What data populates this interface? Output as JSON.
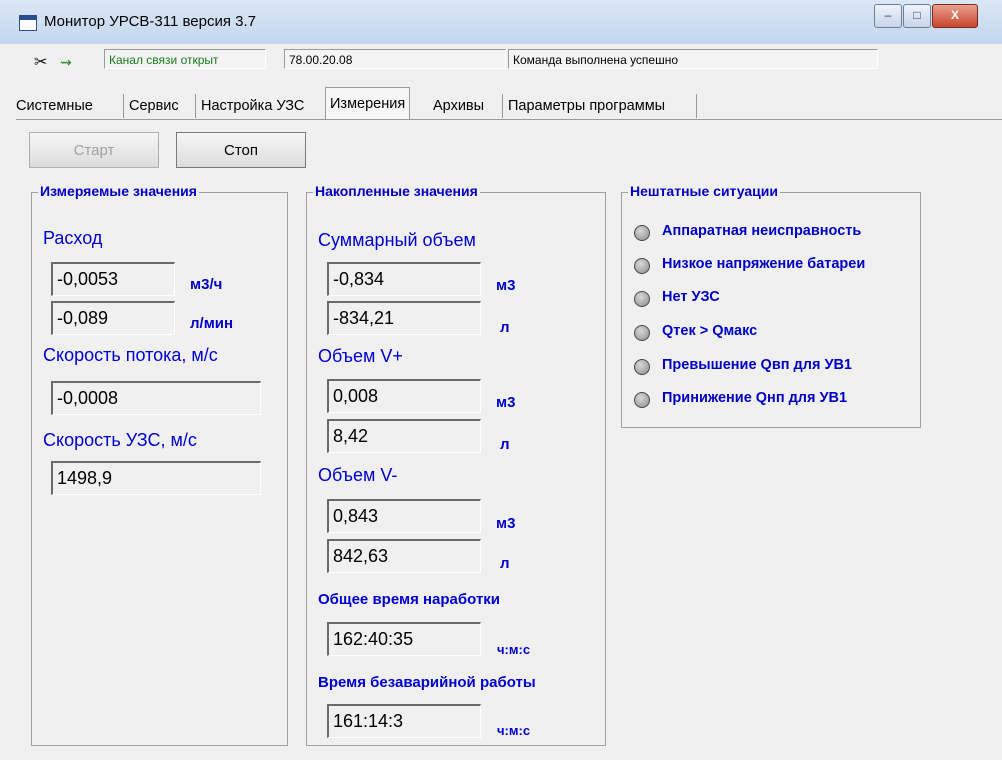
{
  "window": {
    "title": "Монитор УРСВ-311 версия 3.7",
    "minimize": "–",
    "maximize": "□",
    "close": "X"
  },
  "toolbar": {
    "disconnect_icon": "scissors-plug-icon",
    "connect_icon": "plug-arrow-icon",
    "channel_status": "Канал связи открыт",
    "address": "78.00.20.08",
    "command_status": "Команда выполнена успешно"
  },
  "tabs": [
    "Системные",
    "Сервис",
    "Настройка УЗС",
    "Измерения",
    "Архивы",
    "Параметры программы"
  ],
  "active_tab": "Измерения",
  "buttons": {
    "start": "Старт",
    "stop": "Стоп"
  },
  "measured": {
    "title": "Измеряемые значения",
    "flow_label": "Расход",
    "flow_m3h": "-0,0053",
    "flow_m3h_unit": "м3/ч",
    "flow_lmin": "-0,089",
    "flow_lmin_unit": "л/мин",
    "velocity_label": "Скорость потока, м/с",
    "velocity": "-0,0008",
    "uzs_speed_label": "Скорость УЗС, м/с",
    "uzs_speed": "1498,9"
  },
  "accumulated": {
    "title": "Накопленные значения",
    "total_label": "Суммарный объем",
    "total_m3": "-0,834",
    "total_l": "-834,21",
    "vplus_label": "Объем V+",
    "vplus_m3": "0,008",
    "vplus_l": "8,42",
    "vminus_label": "Объем V-",
    "vminus_m3": "0,843",
    "vminus_l": "842,63",
    "unit_m3": "м3",
    "unit_l": "л",
    "runtime_label": "Общее время наработки",
    "runtime": "162:40:35",
    "faultless_label": "Время безаварийной работы",
    "faultless": "161:14:3",
    "time_unit": "ч:м:с"
  },
  "alarms": {
    "title": "Нештатные ситуации",
    "items": [
      "Аппаратная неисправность",
      "Низкое напряжение батареи",
      "Нет УЗС",
      "Qтек > Qмакс",
      "Превышение Qвп для УВ1",
      "Принижение Qнп для УВ1"
    ],
    "lamp_color": "#9a9a9a"
  }
}
